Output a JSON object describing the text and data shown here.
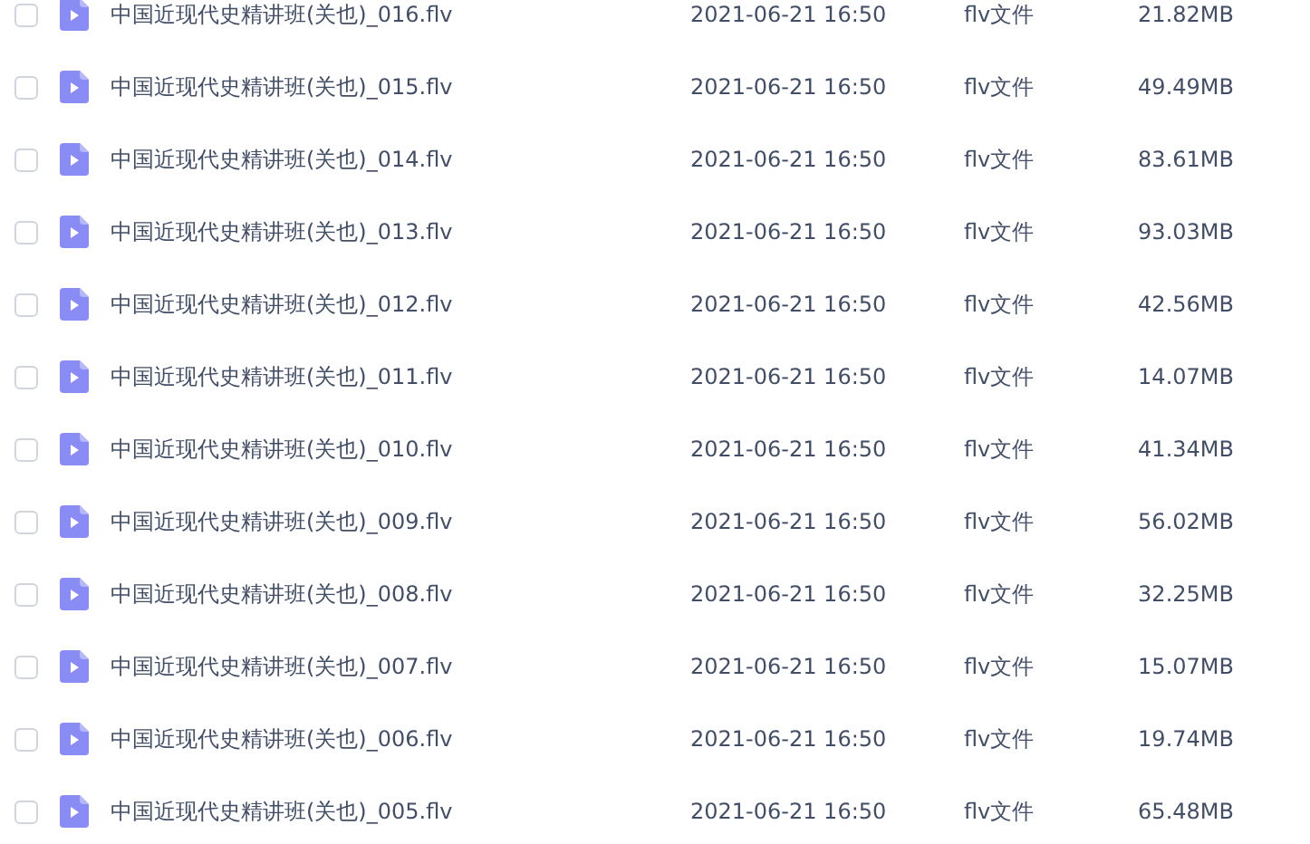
{
  "files": [
    {
      "name": "中国近现代史精讲班(关也)_016.flv",
      "modified": "2021-06-21 16:50",
      "type": "flv文件",
      "size": "21.82MB",
      "selected": false
    },
    {
      "name": "中国近现代史精讲班(关也)_015.flv",
      "modified": "2021-06-21 16:50",
      "type": "flv文件",
      "size": "49.49MB",
      "selected": false
    },
    {
      "name": "中国近现代史精讲班(关也)_014.flv",
      "modified": "2021-06-21 16:50",
      "type": "flv文件",
      "size": "83.61MB",
      "selected": false
    },
    {
      "name": "中国近现代史精讲班(关也)_013.flv",
      "modified": "2021-06-21 16:50",
      "type": "flv文件",
      "size": "93.03MB",
      "selected": false
    },
    {
      "name": "中国近现代史精讲班(关也)_012.flv",
      "modified": "2021-06-21 16:50",
      "type": "flv文件",
      "size": "42.56MB",
      "selected": false
    },
    {
      "name": "中国近现代史精讲班(关也)_011.flv",
      "modified": "2021-06-21 16:50",
      "type": "flv文件",
      "size": "14.07MB",
      "selected": false
    },
    {
      "name": "中国近现代史精讲班(关也)_010.flv",
      "modified": "2021-06-21 16:50",
      "type": "flv文件",
      "size": "41.34MB",
      "selected": false
    },
    {
      "name": "中国近现代史精讲班(关也)_009.flv",
      "modified": "2021-06-21 16:50",
      "type": "flv文件",
      "size": "56.02MB",
      "selected": false
    },
    {
      "name": "中国近现代史精讲班(关也)_008.flv",
      "modified": "2021-06-21 16:50",
      "type": "flv文件",
      "size": "32.25MB",
      "selected": false
    },
    {
      "name": "中国近现代史精讲班(关也)_007.flv",
      "modified": "2021-06-21 16:50",
      "type": "flv文件",
      "size": "15.07MB",
      "selected": false
    },
    {
      "name": "中国近现代史精讲班(关也)_006.flv",
      "modified": "2021-06-21 16:50",
      "type": "flv文件",
      "size": "19.74MB",
      "selected": false
    },
    {
      "name": "中国近现代史精讲班(关也)_005.flv",
      "modified": "2021-06-21 16:50",
      "type": "flv文件",
      "size": "65.48MB",
      "selected": false
    }
  ]
}
